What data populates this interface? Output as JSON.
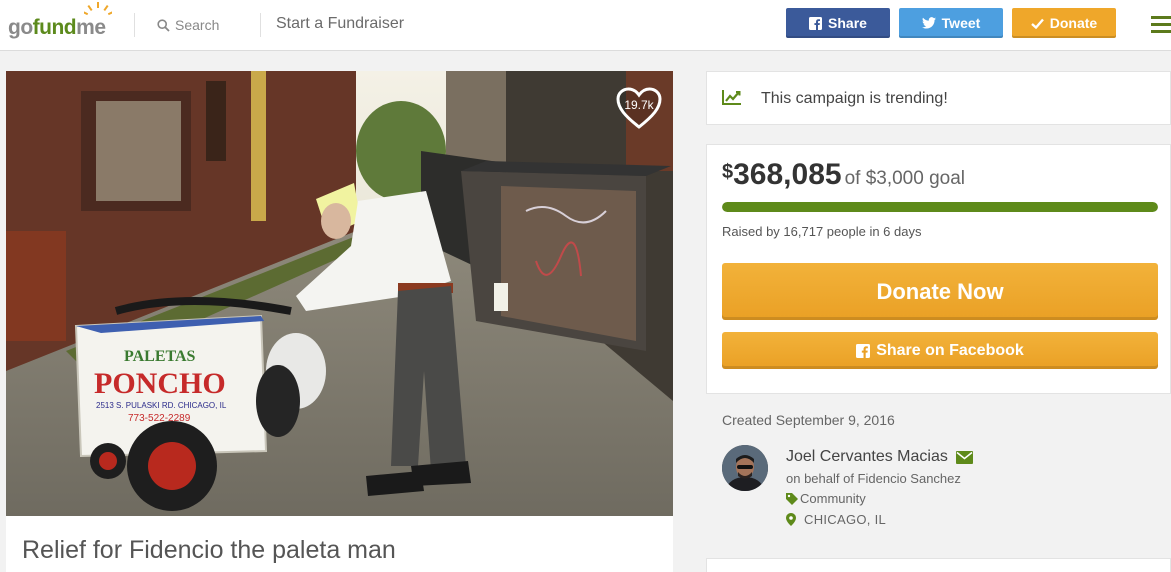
{
  "header": {
    "logo": {
      "go": "go",
      "fund": "fund",
      "me": "me"
    },
    "search_label": "Search",
    "start_label": "Start a Fundraiser",
    "buttons": {
      "share": "Share",
      "tweet": "Tweet",
      "donate": "Donate"
    }
  },
  "campaign": {
    "heart_count": "19.7k",
    "title": "Relief for Fidencio the paleta man",
    "photo": {
      "cart_brand": "PALETAS",
      "cart_name": "PONCHO",
      "cart_address": "2513 S. PULASKI RD. CHICAGO, IL",
      "cart_phone": "773-522-2289"
    }
  },
  "trending": {
    "text": "This campaign is trending!"
  },
  "fundraising": {
    "currency": "$",
    "amount": "368,085",
    "goal_text": "of $3,000 goal",
    "progress_fraction": 1.0,
    "raised_text": "Raised by 16,717 people in 6 days",
    "donate_now_label": "Donate Now",
    "share_facebook_label": "Share on Facebook"
  },
  "details": {
    "created": "Created September 9, 2016",
    "organizer_name": "Joel Cervantes Macias",
    "on_behalf": "on behalf of Fidencio Sanchez",
    "category": "Community",
    "location": "CHICAGO, IL"
  },
  "colors": {
    "brand_green": "#5e8a1a",
    "facebook_blue": "#3b5a9a",
    "twitter_blue": "#4d9fe0",
    "donate_orange": "#efa72a"
  }
}
